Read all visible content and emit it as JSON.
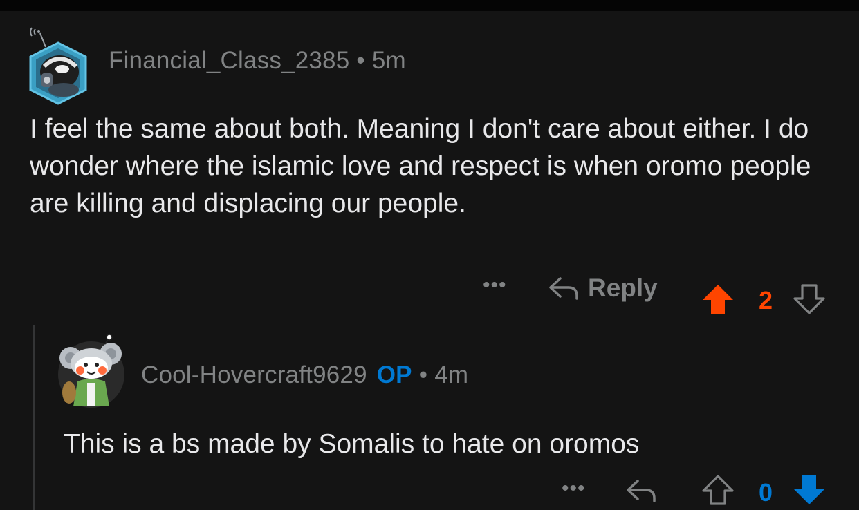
{
  "comments": [
    {
      "username": "Financial_Class_2385",
      "separator": "•",
      "age": "5m",
      "text": "I feel the same about both. Meaning I don't care about either. I do wonder where the islamic love and respect is when oromo people are killing and displacing our people.",
      "more_label": "•••",
      "reply_label": "Reply",
      "vote_count": "2",
      "vote_state": "upvoted",
      "avatar_icon": "snoo-avatar-headset-icon"
    },
    {
      "username": "Cool-Hovercraft9629",
      "op_badge": "OP",
      "separator": "•",
      "age": "4m",
      "text": "This is a bs made by Somalis to hate on oromos",
      "more_label": "•••",
      "vote_count": "0",
      "vote_state": "downvoted",
      "avatar_icon": "snoo-avatar-koala-icon"
    }
  ],
  "colors": {
    "background": "#141414",
    "text": "#e8e8ea",
    "meta": "#818384",
    "upvote": "#ff4500",
    "downvote": "#0079d3",
    "op": "#0079d3",
    "thread_line": "#343536"
  }
}
